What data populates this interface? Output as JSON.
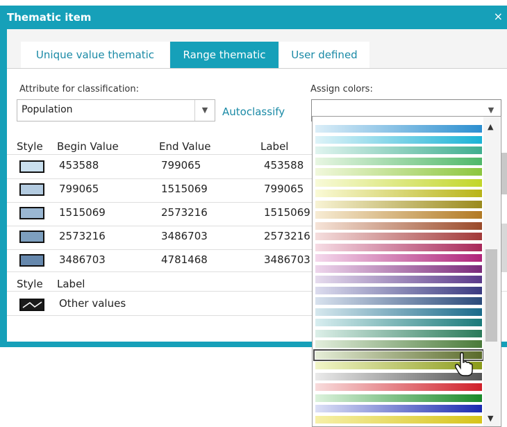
{
  "dialog": {
    "title": "Thematic item",
    "close_glyph": "×"
  },
  "tabs": [
    {
      "label": "Unique value thematic",
      "active": false
    },
    {
      "label": "Range thematic",
      "active": true
    },
    {
      "label": "User defined",
      "active": false
    }
  ],
  "form": {
    "attribute_label": "Attribute for classification:",
    "attribute_value": "Population",
    "autoclassify_label": "Autoclassify",
    "assign_colors_label": "Assign colors:",
    "assign_colors_value": ""
  },
  "table": {
    "headers": [
      "Style",
      "Begin Value",
      "End Value",
      "Label"
    ],
    "rows": [
      {
        "begin": "453588",
        "end": "799065",
        "label": "453588",
        "color": "#c9dfee"
      },
      {
        "begin": "799065",
        "end": "1515069",
        "label": "799065",
        "color": "#b3cbe0"
      },
      {
        "begin": "1515069",
        "end": "2573216",
        "label": "1515069",
        "color": "#9ab7d2"
      },
      {
        "begin": "2573216",
        "end": "3486703",
        "label": "2573216",
        "color": "#7d9fbf"
      },
      {
        "begin": "3486703",
        "end": "4781468",
        "label": "3486703",
        "color": "#6688ad"
      }
    ],
    "other_headers": [
      "Style",
      "Label"
    ],
    "other_label": "Other values"
  },
  "color_ramps": [
    {
      "from": "#dbeef8",
      "to": "#2c8fd0"
    },
    {
      "from": "#def3f8",
      "to": "#1ab3d6"
    },
    {
      "from": "#e0f4ef",
      "to": "#3fae8f"
    },
    {
      "from": "#e8f6e2",
      "to": "#4fb86a"
    },
    {
      "from": "#f1f8dc",
      "to": "#8cc63f"
    },
    {
      "from": "#f8fad8",
      "to": "#c2d62a"
    },
    {
      "from": "#fafad6",
      "to": "#b8b418"
    },
    {
      "from": "#f8f3d4",
      "to": "#9a8a1c"
    },
    {
      "from": "#f7ecd4",
      "to": "#b27a24"
    },
    {
      "from": "#f6e4d8",
      "to": "#9a4a2a"
    },
    {
      "from": "#f5dede",
      "to": "#a23a3a"
    },
    {
      "from": "#f6dce4",
      "to": "#a8285a"
    },
    {
      "from": "#f4d8ec",
      "to": "#b0247a"
    },
    {
      "from": "#eed6ec",
      "to": "#7a2a7a"
    },
    {
      "from": "#e6dcee",
      "to": "#5a3a8a"
    },
    {
      "from": "#dcdcee",
      "to": "#3a3a80"
    },
    {
      "from": "#d8e2ee",
      "to": "#2a4a7a"
    },
    {
      "from": "#d6e8ee",
      "to": "#1a6a8a"
    },
    {
      "from": "#d8eef0",
      "to": "#1a7a7a"
    },
    {
      "from": "#dcefe8",
      "to": "#2a7a5a"
    },
    {
      "from": "#e2eedc",
      "to": "#4a7a3a"
    },
    {
      "from": "#e6eed8",
      "to": "#5a6a2a",
      "selected": true
    },
    {
      "from": "#f2f6c8",
      "to": "#8a9a1a"
    },
    {
      "from": "#eaeaea",
      "to": "#555555"
    },
    {
      "from": "#f8dcdc",
      "to": "#d0202a"
    },
    {
      "from": "#dcf2dc",
      "to": "#1a8a2a"
    },
    {
      "from": "#dce0f6",
      "to": "#1a2ab0"
    },
    {
      "from": "#f6f0a8",
      "to": "#d6c41a"
    }
  ]
}
